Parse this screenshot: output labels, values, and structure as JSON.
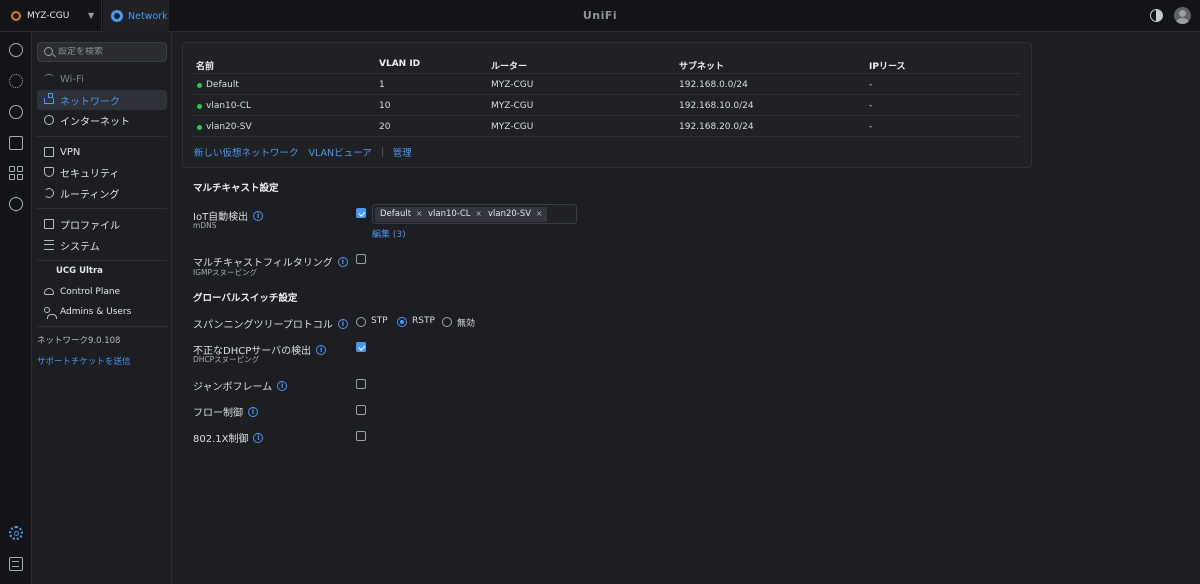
{
  "topbar": {
    "site_name": "MYZ-CGU",
    "app_name": "Network",
    "brand": "UniFi"
  },
  "search": {
    "placeholder": "設定を検索"
  },
  "nav": {
    "wifi": "Wi-Fi",
    "network": "ネットワーク",
    "internet": "インターネット",
    "vpn": "VPN",
    "security": "セキュリティ",
    "routing": "ルーティング",
    "profiles": "プロファイル",
    "system": "システム",
    "device_section": "UCG Ultra",
    "control_plane": "Control Plane",
    "admins_users": "Admins & Users",
    "version": "ネットワーク9.0.108",
    "support": "サポートチケットを送信"
  },
  "networks_table": {
    "headers": [
      "名前",
      "VLAN ID",
      "ルーター",
      "サブネット",
      "IPリース"
    ],
    "rows": [
      {
        "name": "Default",
        "vlan": "1",
        "router": "MYZ-CGU",
        "subnet": "192.168.0.0/24",
        "ip_lease": "-"
      },
      {
        "name": "vlan10-CL",
        "vlan": "10",
        "router": "MYZ-CGU",
        "subnet": "192.168.10.0/24",
        "ip_lease": "-"
      },
      {
        "name": "vlan20-SV",
        "vlan": "20",
        "router": "MYZ-CGU",
        "subnet": "192.168.20.0/24",
        "ip_lease": "-"
      }
    ],
    "links": {
      "new_network": "新しい仮想ネットワーク",
      "vlan_viewer": "VLANビューア",
      "manage": "管理"
    }
  },
  "multicast": {
    "heading": "マルチキャスト設定",
    "iot": {
      "label": "IoT自動検出",
      "sub": "mDNS",
      "checked": true,
      "tags": [
        "Default",
        "vlan10-CL",
        "vlan20-SV"
      ],
      "tag_remove": "×",
      "edit": "編集 (3)"
    },
    "filtering": {
      "label": "マルチキャストフィルタリング",
      "sub": "IGMPスヌーピング",
      "checked": false
    }
  },
  "switch": {
    "heading": "グローバルスイッチ設定",
    "stp": {
      "label": "スパンニングツリープロトコル",
      "options": [
        "STP",
        "RSTP",
        "無効"
      ],
      "selected": "RSTP"
    },
    "dhcp": {
      "label": "不正なDHCPサーバの検出",
      "sub": "DHCPスヌーピング",
      "checked": true
    },
    "jumbo": {
      "label": "ジャンボフレーム",
      "checked": false
    },
    "flow": {
      "label": "フロー制御",
      "checked": false
    },
    "dot1x": {
      "label": "802.1X制御",
      "checked": false
    }
  },
  "icons": {
    "info": "i"
  },
  "colors": {
    "accent": "#4c97f2",
    "status_ok": "#38c35a",
    "background": "#1c1e22"
  }
}
